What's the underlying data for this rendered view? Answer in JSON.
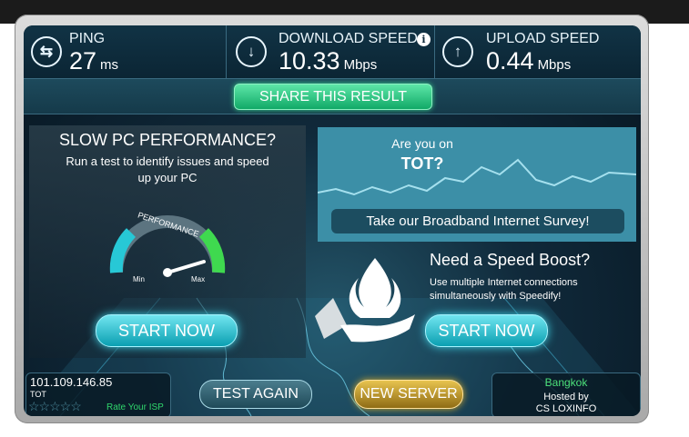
{
  "stats": {
    "ping": {
      "label": "PING",
      "value": "27",
      "unit": "ms",
      "icon": "exchange-arrows-icon"
    },
    "download": {
      "label": "DOWNLOAD SPEED",
      "value": "10.33",
      "unit": "Mbps",
      "icon": "down-arrow-icon"
    },
    "upload": {
      "label": "UPLOAD SPEED",
      "value": "0.44",
      "unit": "Mbps",
      "icon": "up-arrow-icon"
    },
    "info_icon": "info-icon"
  },
  "share": {
    "label": "SHARE THIS RESULT"
  },
  "pc_promo": {
    "title": "SLOW PC PERFORMANCE?",
    "subtitle": "Run a test to identify issues and speed up your PC",
    "gauge_label": "PERFORMANCE",
    "gauge_min": "Min",
    "gauge_max": "Max",
    "button": "START NOW"
  },
  "survey": {
    "question_line1": "Are you on",
    "question_line2": "TOT?",
    "button": "Take our Broadband Internet Survey!"
  },
  "boost": {
    "title": "Need a Speed Boost?",
    "subtitle": "Use multiple Internet connections simultaneously with Speedify!",
    "button": "START NOW",
    "icon": "flame-hand-icon"
  },
  "client": {
    "ip": "101.109.146.85",
    "isp": "TOT",
    "rating_stars": 0,
    "rate_label": "Rate Your ISP"
  },
  "actions": {
    "test_again": "TEST AGAIN",
    "new_server": "NEW SERVER"
  },
  "server": {
    "city": "Bangkok",
    "hosted_by": "Hosted by",
    "host": "CS LOXINFO"
  },
  "colors": {
    "accent_green": "#11a967",
    "accent_cyan": "#0a9fb1",
    "accent_gold": "#e7c34f",
    "survey_bg": "#3c8fa7"
  }
}
